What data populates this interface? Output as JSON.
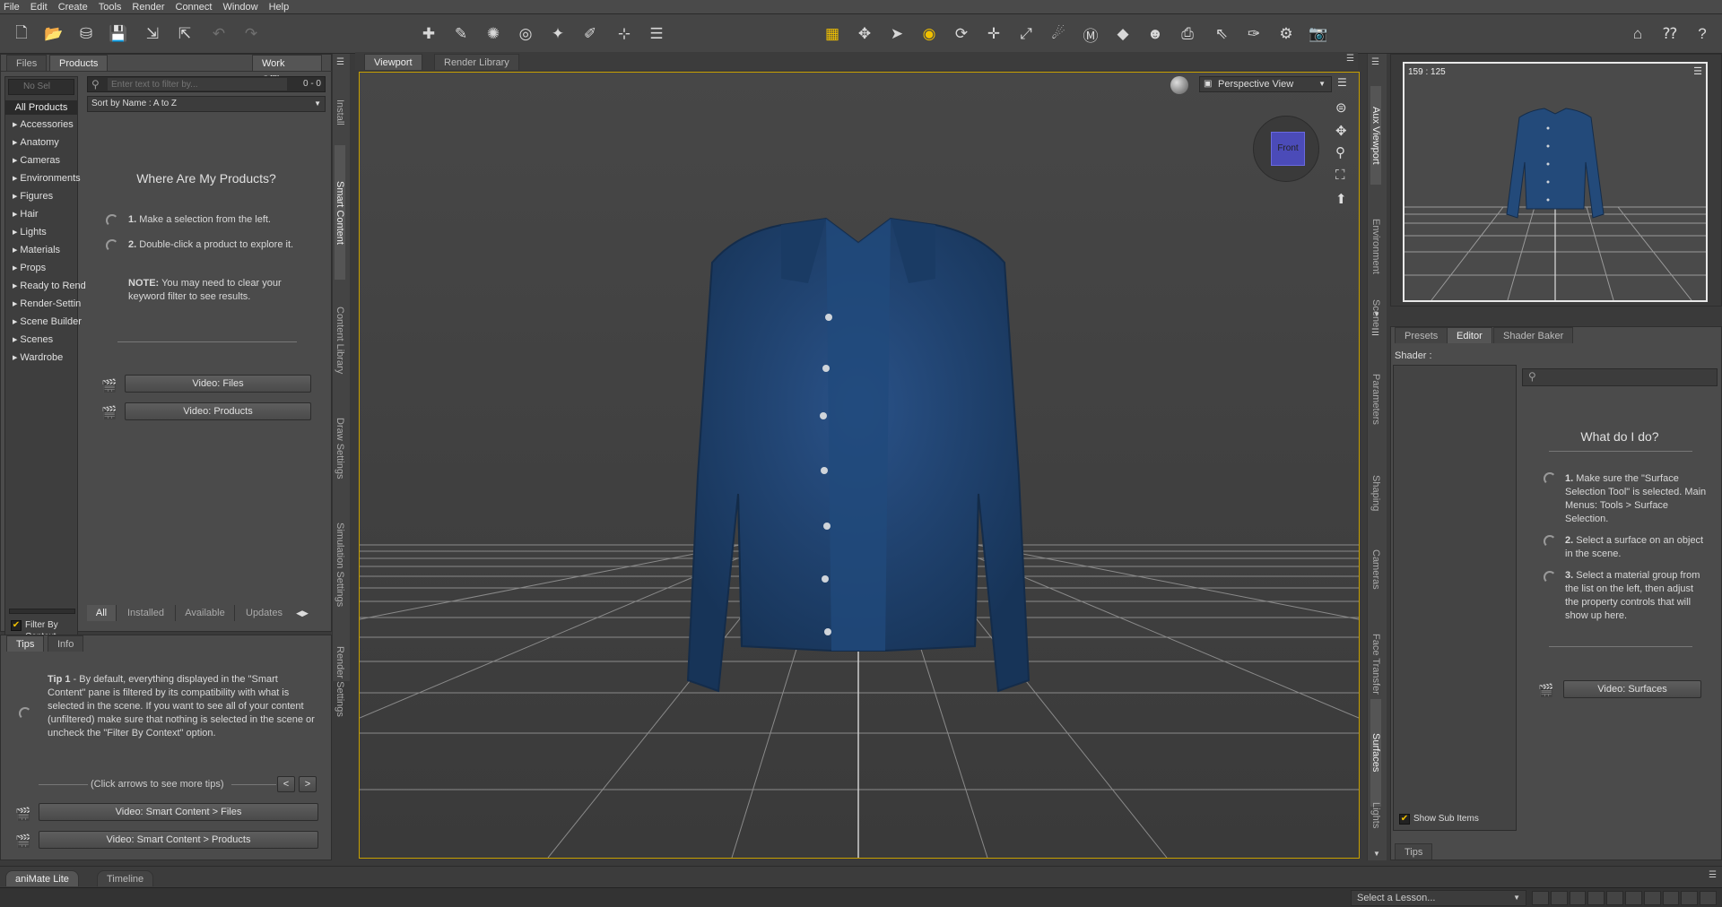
{
  "menu": [
    "File",
    "Edit",
    "Create",
    "Tools",
    "Render",
    "Connect",
    "Window",
    "Help"
  ],
  "left_panel": {
    "tabs": [
      "Files",
      "Products"
    ],
    "active_tab": "Products",
    "work_offline": "Work Offline",
    "filter_placeholder": "Enter text to filter by...",
    "count": "0 - 0",
    "no_sel": "No Sel",
    "sort": "Sort by Name : A to Z",
    "all_products": "All Products",
    "categories": [
      "Accessories",
      "Anatomy",
      "Cameras",
      "Environments",
      "Figures",
      "Hair",
      "Lights",
      "Materials",
      "Props",
      "Ready to Rend",
      "Render-Settin",
      "Scene Builder",
      "Scenes",
      "Wardrobe"
    ],
    "help_title": "Where Are My Products?",
    "step1_num": "1.",
    "step1": "Make a selection from the left.",
    "step2_num": "2.",
    "step2": "Double-click a product to explore it.",
    "note_label": "NOTE:",
    "note": "You may need to clear your keyword filter to see results.",
    "video_files": "Video: Files",
    "video_products": "Video: Products",
    "filter_by_context": "Filter By Context",
    "bottom_tabs": [
      "All",
      "Installed",
      "Available",
      "Updates"
    ],
    "side_tabs": [
      "Install",
      "Smart Content",
      "Content Library",
      "Draw Settings",
      "Simulation Settings",
      "Render Settings"
    ]
  },
  "tips_panel": {
    "tabs": [
      "Tips",
      "Info"
    ],
    "tip_label": "Tip 1",
    "tip": " - By default, everything displayed in the \"Smart Content\" pane is filtered by its compatibility with what is selected in the scene. If you want to see all of your content (unfiltered) make sure that nothing is selected in the scene or uncheck the \"Filter By Context\" option.",
    "arrows_hint": "(Click arrows to see more tips)",
    "prev": "<",
    "next": ">",
    "video1": "Video: Smart Content > Files",
    "video2": "Video: Smart Content > Products"
  },
  "viewport": {
    "tabs": [
      "Viewport",
      "Render Library"
    ],
    "active_tab": "Viewport",
    "camera": "Perspective View",
    "cube_label": "Front"
  },
  "aux": {
    "coords": "159 : 125",
    "side_tabs": [
      "Aux Viewport",
      "Environment",
      "Scene"
    ]
  },
  "surfaces": {
    "tabs": [
      "Presets",
      "Editor",
      "Shader Baker"
    ],
    "active_tab": "Editor",
    "shader_label": "Shader :",
    "help_title": "What do I do?",
    "step1_num": "1.",
    "step1": "Make sure the \"Surface Selection Tool\" is selected. Main Menus: Tools > Surface Selection.",
    "step2_num": "2.",
    "step2": "Select a surface on an object in the scene.",
    "step3_num": "3.",
    "step3": "Select a material group from the list on the left, then adjust the property controls that will show up here.",
    "video": "Video: Surfaces",
    "show_sub_items": "Show Sub Items",
    "tips_tab": "Tips",
    "side_tabs": [
      "Parameters",
      "Shaping",
      "Cameras",
      "Face Transfer",
      "Surfaces",
      "Lights"
    ]
  },
  "bottom": {
    "tabs": [
      "aniMate Lite",
      "Timeline"
    ],
    "lesson": "Select a Lesson..."
  },
  "colors": {
    "accent": "#f0c000",
    "shirt": "#1f4575",
    "bg": "#3a3a3a"
  }
}
